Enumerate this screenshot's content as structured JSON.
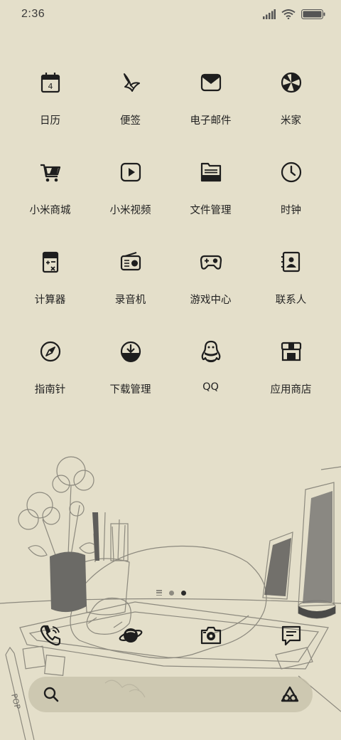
{
  "status_bar": {
    "time": "2:36",
    "icons": [
      "signal-icon",
      "wifi-icon",
      "battery-icon"
    ]
  },
  "apps": [
    {
      "label": "日历",
      "icon": "calendar-icon",
      "calendar_day": "4"
    },
    {
      "label": "便签",
      "icon": "notes-icon"
    },
    {
      "label": "电子邮件",
      "icon": "mail-icon"
    },
    {
      "label": "米家",
      "icon": "mijia-icon"
    },
    {
      "label": "小米商城",
      "icon": "shopping-cart-icon"
    },
    {
      "label": "小米视频",
      "icon": "video-play-icon"
    },
    {
      "label": "文件管理",
      "icon": "folder-icon"
    },
    {
      "label": "时钟",
      "icon": "clock-icon"
    },
    {
      "label": "计算器",
      "icon": "calculator-icon"
    },
    {
      "label": "录音机",
      "icon": "radio-recorder-icon"
    },
    {
      "label": "游戏中心",
      "icon": "gamepad-icon"
    },
    {
      "label": "联系人",
      "icon": "contacts-icon"
    },
    {
      "label": "指南针",
      "icon": "compass-icon"
    },
    {
      "label": "下载管理",
      "icon": "download-icon"
    },
    {
      "label": "QQ",
      "icon": "qq-penguin-icon"
    },
    {
      "label": "应用商店",
      "icon": "app-store-icon"
    }
  ],
  "page_indicator": {
    "pages": 2,
    "active": 1
  },
  "dock": [
    {
      "icon": "phone-icon"
    },
    {
      "icon": "browser-planet-icon"
    },
    {
      "icon": "camera-icon"
    },
    {
      "icon": "messages-icon"
    }
  ],
  "search_bar": {
    "left_icon": "search-icon",
    "right_icon": "assistant-icon"
  },
  "wallpaper": {
    "subject": "sleeping cat on a tablet with flowers, books and pencils",
    "background_color": "#e4dfca",
    "pencil_text": "POP"
  }
}
